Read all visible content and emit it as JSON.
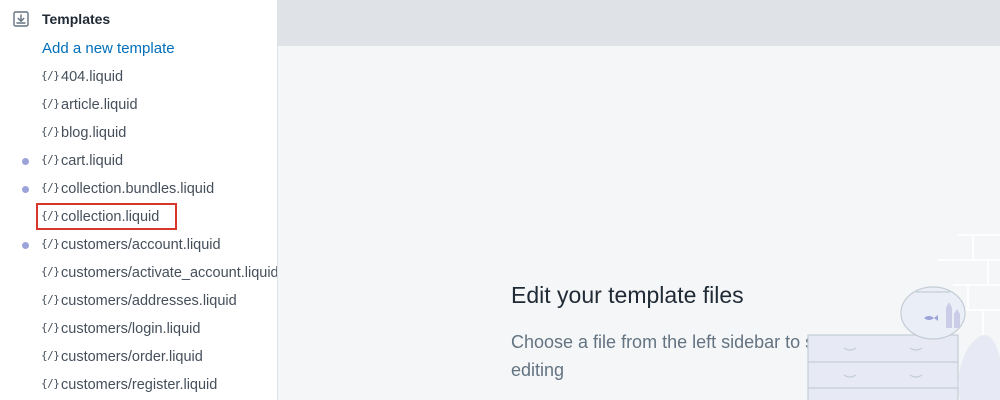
{
  "sidebar": {
    "section_title": "Templates",
    "add_link": "Add a new template",
    "code_icon_glyph": "{/}",
    "files": [
      {
        "name": "404.liquid",
        "modified": false
      },
      {
        "name": "article.liquid",
        "modified": false
      },
      {
        "name": "blog.liquid",
        "modified": false
      },
      {
        "name": "cart.liquid",
        "modified": true
      },
      {
        "name": "collection.bundles.liquid",
        "modified": true
      },
      {
        "name": "collection.liquid",
        "modified": false,
        "highlighted": true
      },
      {
        "name": "customers/account.liquid",
        "modified": true
      },
      {
        "name": "customers/activate_account.liquid",
        "modified": false
      },
      {
        "name": "customers/addresses.liquid",
        "modified": false
      },
      {
        "name": "customers/login.liquid",
        "modified": false
      },
      {
        "name": "customers/order.liquid",
        "modified": false
      },
      {
        "name": "customers/register.liquid",
        "modified": false
      }
    ]
  },
  "main": {
    "empty_title": "Edit your template files",
    "empty_body": "Choose a file from the left sidebar to start editing"
  },
  "colors": {
    "link": "#006fbb",
    "modified_dot": "#9ca3d9",
    "highlight": "#d9362b",
    "topbar": "#dfe3e8",
    "background": "#f4f6f8"
  }
}
